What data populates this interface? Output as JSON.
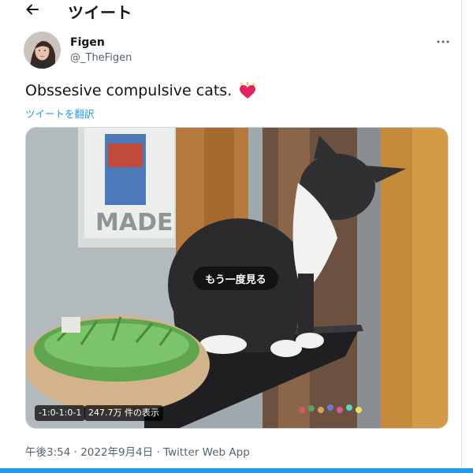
{
  "header": {
    "back_icon": "arrow-left-icon",
    "title": "ツイート"
  },
  "author": {
    "name": "Figen",
    "handle": "@_TheFigen",
    "more_icon": "more-horizontal-icon"
  },
  "tweet": {
    "text": "Obssesive compulsive cats.",
    "emoji": "heart-icon",
    "emoji_color": "#e0245e",
    "translate_label": "ツイートを翻訳"
  },
  "media": {
    "replay_label": "もう一度見る",
    "time_label": "-1:0-1:0-1",
    "views_label": "247.7万 件の表示"
  },
  "meta": {
    "time": "午後3:54",
    "separator1": " · ",
    "date": "2022年9月4日",
    "separator2": " · ",
    "app": "Twitter Web App"
  },
  "colors": {
    "accent": "#1d9bf0",
    "secondary_text": "#536471"
  }
}
